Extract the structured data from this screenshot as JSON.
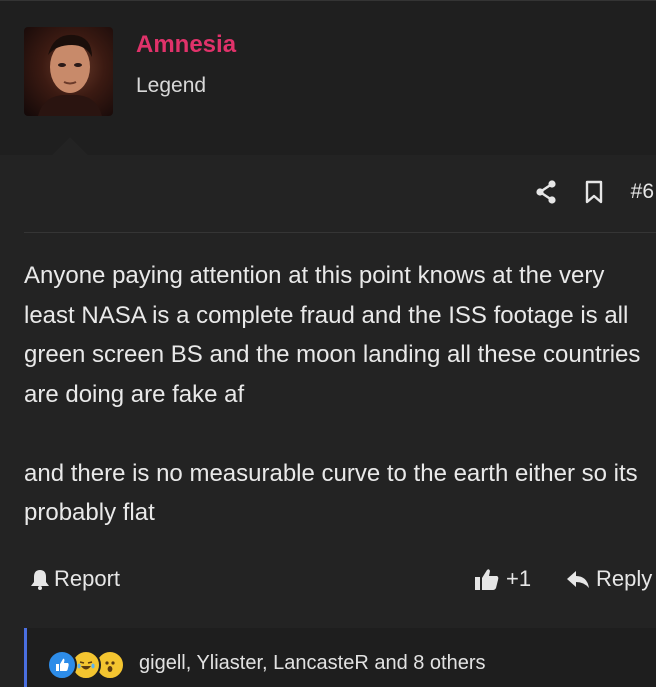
{
  "post": {
    "author": "Amnesia",
    "author_title": "Legend",
    "number": "#6",
    "paragraphs": [
      "Anyone paying attention at this point knows at the very least NASA is a complete fraud and the ISS footage is all green screen BS and the moon landing all these countries are doing are fake af",
      "and there is no measurable curve to the earth either so its probably flat"
    ]
  },
  "footer": {
    "report_label": "Report",
    "like_count": "+1",
    "reply_label": "Reply"
  },
  "reactions": {
    "icons": [
      "like-reaction-icon",
      "laugh-reaction-icon",
      "wow-reaction-icon"
    ],
    "text": "gigell, Yliaster, LancasteR and 8 others"
  },
  "colors": {
    "username": "#e0326a",
    "reaction_bar_accent": "#4a6fe0",
    "background": "#232323"
  }
}
